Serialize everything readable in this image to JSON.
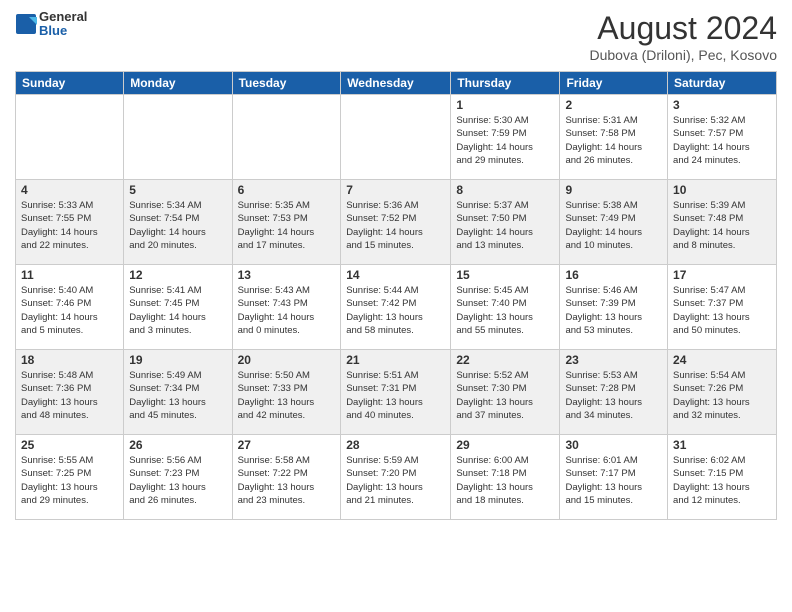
{
  "header": {
    "logo": {
      "general": "General",
      "blue": "Blue"
    },
    "title": "August 2024",
    "subtitle": "Dubova (Driloni), Pec, Kosovo"
  },
  "weekdays": [
    "Sunday",
    "Monday",
    "Tuesday",
    "Wednesday",
    "Thursday",
    "Friday",
    "Saturday"
  ],
  "weeks": [
    [
      {
        "day": "",
        "info": ""
      },
      {
        "day": "",
        "info": ""
      },
      {
        "day": "",
        "info": ""
      },
      {
        "day": "",
        "info": ""
      },
      {
        "day": "1",
        "info": "Sunrise: 5:30 AM\nSunset: 7:59 PM\nDaylight: 14 hours\nand 29 minutes."
      },
      {
        "day": "2",
        "info": "Sunrise: 5:31 AM\nSunset: 7:58 PM\nDaylight: 14 hours\nand 26 minutes."
      },
      {
        "day": "3",
        "info": "Sunrise: 5:32 AM\nSunset: 7:57 PM\nDaylight: 14 hours\nand 24 minutes."
      }
    ],
    [
      {
        "day": "4",
        "info": "Sunrise: 5:33 AM\nSunset: 7:55 PM\nDaylight: 14 hours\nand 22 minutes."
      },
      {
        "day": "5",
        "info": "Sunrise: 5:34 AM\nSunset: 7:54 PM\nDaylight: 14 hours\nand 20 minutes."
      },
      {
        "day": "6",
        "info": "Sunrise: 5:35 AM\nSunset: 7:53 PM\nDaylight: 14 hours\nand 17 minutes."
      },
      {
        "day": "7",
        "info": "Sunrise: 5:36 AM\nSunset: 7:52 PM\nDaylight: 14 hours\nand 15 minutes."
      },
      {
        "day": "8",
        "info": "Sunrise: 5:37 AM\nSunset: 7:50 PM\nDaylight: 14 hours\nand 13 minutes."
      },
      {
        "day": "9",
        "info": "Sunrise: 5:38 AM\nSunset: 7:49 PM\nDaylight: 14 hours\nand 10 minutes."
      },
      {
        "day": "10",
        "info": "Sunrise: 5:39 AM\nSunset: 7:48 PM\nDaylight: 14 hours\nand 8 minutes."
      }
    ],
    [
      {
        "day": "11",
        "info": "Sunrise: 5:40 AM\nSunset: 7:46 PM\nDaylight: 14 hours\nand 5 minutes."
      },
      {
        "day": "12",
        "info": "Sunrise: 5:41 AM\nSunset: 7:45 PM\nDaylight: 14 hours\nand 3 minutes."
      },
      {
        "day": "13",
        "info": "Sunrise: 5:43 AM\nSunset: 7:43 PM\nDaylight: 14 hours\nand 0 minutes."
      },
      {
        "day": "14",
        "info": "Sunrise: 5:44 AM\nSunset: 7:42 PM\nDaylight: 13 hours\nand 58 minutes."
      },
      {
        "day": "15",
        "info": "Sunrise: 5:45 AM\nSunset: 7:40 PM\nDaylight: 13 hours\nand 55 minutes."
      },
      {
        "day": "16",
        "info": "Sunrise: 5:46 AM\nSunset: 7:39 PM\nDaylight: 13 hours\nand 53 minutes."
      },
      {
        "day": "17",
        "info": "Sunrise: 5:47 AM\nSunset: 7:37 PM\nDaylight: 13 hours\nand 50 minutes."
      }
    ],
    [
      {
        "day": "18",
        "info": "Sunrise: 5:48 AM\nSunset: 7:36 PM\nDaylight: 13 hours\nand 48 minutes."
      },
      {
        "day": "19",
        "info": "Sunrise: 5:49 AM\nSunset: 7:34 PM\nDaylight: 13 hours\nand 45 minutes."
      },
      {
        "day": "20",
        "info": "Sunrise: 5:50 AM\nSunset: 7:33 PM\nDaylight: 13 hours\nand 42 minutes."
      },
      {
        "day": "21",
        "info": "Sunrise: 5:51 AM\nSunset: 7:31 PM\nDaylight: 13 hours\nand 40 minutes."
      },
      {
        "day": "22",
        "info": "Sunrise: 5:52 AM\nSunset: 7:30 PM\nDaylight: 13 hours\nand 37 minutes."
      },
      {
        "day": "23",
        "info": "Sunrise: 5:53 AM\nSunset: 7:28 PM\nDaylight: 13 hours\nand 34 minutes."
      },
      {
        "day": "24",
        "info": "Sunrise: 5:54 AM\nSunset: 7:26 PM\nDaylight: 13 hours\nand 32 minutes."
      }
    ],
    [
      {
        "day": "25",
        "info": "Sunrise: 5:55 AM\nSunset: 7:25 PM\nDaylight: 13 hours\nand 29 minutes."
      },
      {
        "day": "26",
        "info": "Sunrise: 5:56 AM\nSunset: 7:23 PM\nDaylight: 13 hours\nand 26 minutes."
      },
      {
        "day": "27",
        "info": "Sunrise: 5:58 AM\nSunset: 7:22 PM\nDaylight: 13 hours\nand 23 minutes."
      },
      {
        "day": "28",
        "info": "Sunrise: 5:59 AM\nSunset: 7:20 PM\nDaylight: 13 hours\nand 21 minutes."
      },
      {
        "day": "29",
        "info": "Sunrise: 6:00 AM\nSunset: 7:18 PM\nDaylight: 13 hours\nand 18 minutes."
      },
      {
        "day": "30",
        "info": "Sunrise: 6:01 AM\nSunset: 7:17 PM\nDaylight: 13 hours\nand 15 minutes."
      },
      {
        "day": "31",
        "info": "Sunrise: 6:02 AM\nSunset: 7:15 PM\nDaylight: 13 hours\nand 12 minutes."
      }
    ]
  ]
}
